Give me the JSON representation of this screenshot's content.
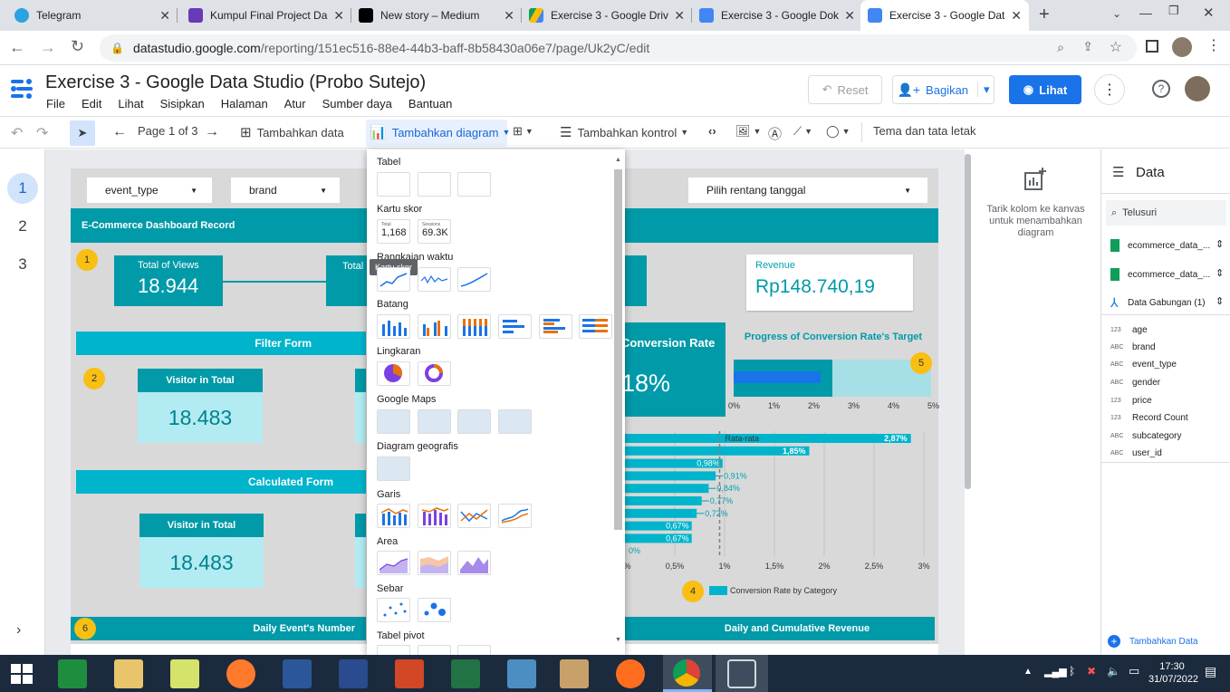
{
  "browser": {
    "tabs": [
      {
        "title": "Telegram",
        "color": "#2aa3df"
      },
      {
        "title": "Kumpul Final Project Da",
        "color": "#673ab7"
      },
      {
        "title": "New story – Medium",
        "color": "#000000"
      },
      {
        "title": "Exercise 3 - Google Driv",
        "color": "#fbbc04"
      },
      {
        "title": "Exercise 3 - Google Dok",
        "color": "#4285f4"
      },
      {
        "title": "Exercise 3 - Google Dat",
        "color": "#4285f4"
      }
    ],
    "url_host": "datastudio.google.com",
    "url_path": "/reporting/151ec516-88e4-44b3-baff-8b58430a06e7/page/Uk2yC/edit"
  },
  "app": {
    "title": "Exercise 3 - Google Data Studio (Probo Sutejo)",
    "menu": [
      "File",
      "Edit",
      "Lihat",
      "Sisipkan",
      "Halaman",
      "Atur",
      "Sumber daya",
      "Bantuan"
    ],
    "reset": "Reset",
    "share": "Bagikan",
    "view": "Lihat"
  },
  "toolbar": {
    "page": "Page 1 of 3",
    "add_data": "Tambahkan data",
    "add_chart": "Tambahkan diagram",
    "add_control": "Tambahkan kontrol",
    "theme": "Tema dan tata letak"
  },
  "pages": [
    "1",
    "2",
    "3"
  ],
  "report": {
    "filter1": "event_type",
    "filter2": "brand",
    "date": "Pilih rentang tanggal",
    "header": "E-Commerce Dashboard Record",
    "total_views_label": "Total of Views",
    "total_views": "18.944",
    "total2_label": "Total",
    "revenue_label": "Revenue",
    "revenue": "Rp148.740,19",
    "filter_form": "Filter Form",
    "visitor_label": "Visitor in Total",
    "visitor": "18.483",
    "calc_form": "Calculated Form",
    "visitor2_label": "Visitor in Total",
    "visitor2": "18.483",
    "conv_rate_label": "Conversion Rate",
    "conv_rate": "18%",
    "progress_title": "Progress of Conversion Rate's Target",
    "progress_ticks": [
      "0%",
      "1%",
      "2%",
      "3%",
      "4%",
      "5%"
    ],
    "bar_avg": "Rata-rata",
    "bar_ticks": [
      "0%",
      "0,5%",
      "1%",
      "1,5%",
      "2%",
      "2,5%",
      "3%"
    ],
    "bar_legend": "Conversion Rate by Category",
    "daily_events": "Daily Event's Number",
    "daily_revenue": "Daily and Cumulative Revenue",
    "badges": [
      "1",
      "2",
      "4",
      "5",
      "6"
    ]
  },
  "chart_data": {
    "type": "bar",
    "categories": [
      "",
      "",
      "",
      "",
      "",
      "",
      "",
      "",
      "",
      ""
    ],
    "values": [
      2.87,
      1.85,
      0.98,
      0.91,
      0.84,
      0.77,
      0.72,
      0.67,
      0.67,
      0
    ],
    "labels": [
      "2,87%",
      "1,85%",
      "0,98%",
      "0,91%",
      "0,84%",
      "0,77%",
      "0,72%",
      "0,67%",
      "0,67%",
      "0%"
    ],
    "xlim": [
      0,
      3
    ],
    "average": 0.95,
    "color": "#00b4cc"
  },
  "progress_data": {
    "value": 2.2,
    "target": 5,
    "fill": "#1a73e8",
    "track": "#a7dfe6"
  },
  "chart_menu": {
    "categories": [
      "Tabel",
      "Kartu skor",
      "Rangkaian waktu",
      "Batang",
      "Lingkaran",
      "Google Maps",
      "Diagram geografis",
      "Garis",
      "Area",
      "Sebar",
      "Tabel pivot"
    ],
    "scorecard1_label": "Total",
    "scorecard1_value": "1,168",
    "scorecard2_label": "Sessions",
    "scorecard2_value": "69.3K",
    "tooltip": "Kartu skor"
  },
  "props_panel": {
    "hint": "Tarik kolom ke kanvas untuk menambahkan diagram"
  },
  "data_panel": {
    "title": "Data",
    "search": "Telusuri",
    "sources": [
      "ecommerce_data_...",
      "ecommerce_data_...",
      "Data Gabungan (1)"
    ],
    "fields": [
      {
        "type": "123",
        "name": "age"
      },
      {
        "type": "ABC",
        "name": "brand"
      },
      {
        "type": "ABC",
        "name": "event_type"
      },
      {
        "type": "ABC",
        "name": "gender"
      },
      {
        "type": "123",
        "name": "price"
      },
      {
        "type": "123",
        "name": "Record Count"
      },
      {
        "type": "ABC",
        "name": "subcategory"
      },
      {
        "type": "ABC",
        "name": "user_id"
      }
    ],
    "add_data": "Tambahkan Data"
  },
  "taskbar": {
    "time": "17:30",
    "date": "31/07/2022"
  }
}
